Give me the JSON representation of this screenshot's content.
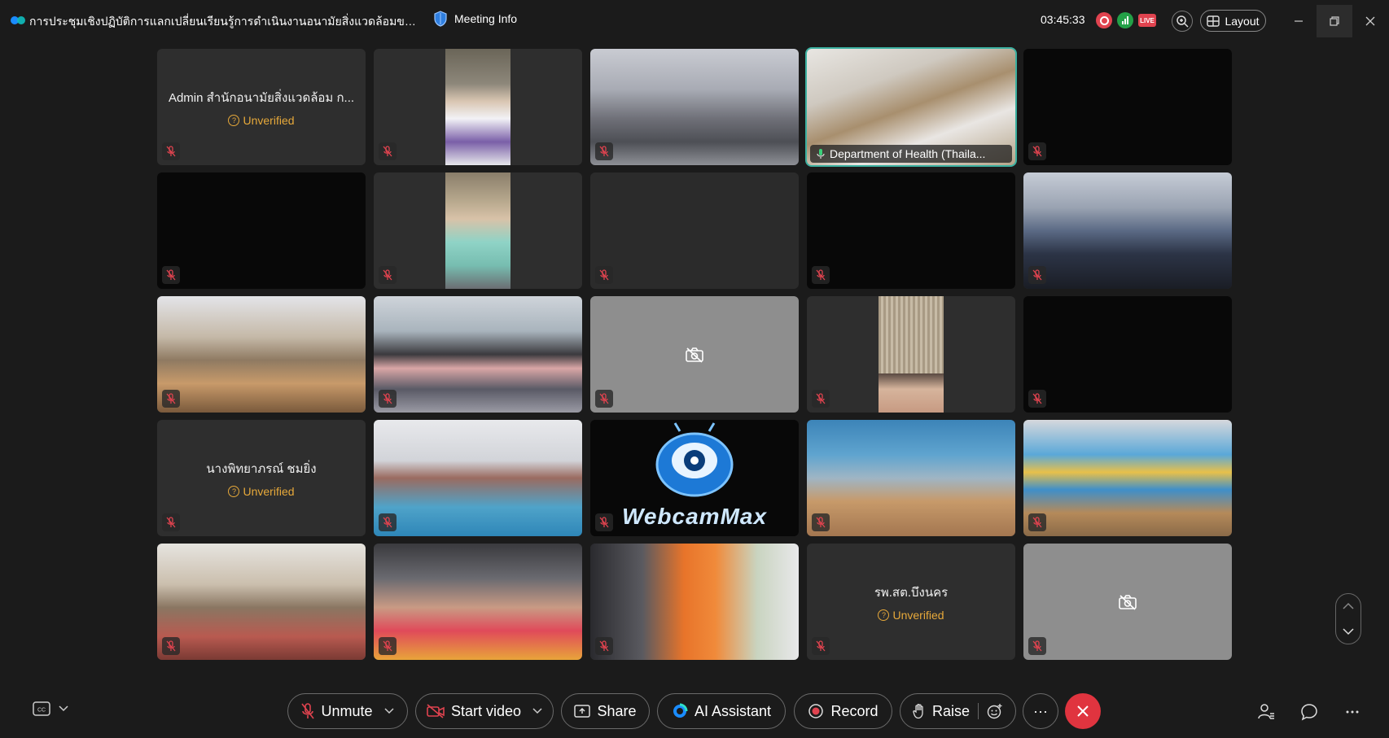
{
  "titlebar": {
    "meeting_title": "การประชุมเชิงปฏิบัติการแลกเปลี่ยนเรียนรู้การดำเนินงานอนามัยสิ่งแวดล้อมของอาสา...",
    "meeting_info_label": "Meeting Info",
    "elapsed_time": "03:45:33",
    "live_badge": "LIVE",
    "layout_label": "Layout"
  },
  "tiles": [
    {
      "name": "Admin สำนักอนามัยสิ่งแวดล้อม ก...",
      "status": "Unverified"
    },
    {
      "name": "Department of Health (Thaila..."
    },
    {
      "name": "นางพิทยาภรณ์ ชมยิ่ง",
      "status": "Unverified"
    },
    {
      "name": "รพ.สต.บึงนคร",
      "status": "Unverified"
    },
    {
      "overlay_text": "WebcamMax"
    }
  ],
  "toolbar": {
    "unmute_label": "Unmute",
    "start_video_label": "Start video",
    "share_label": "Share",
    "ai_assistant_label": "AI Assistant",
    "record_label": "Record",
    "raise_label": "Raise",
    "more_label": "···"
  },
  "colors": {
    "background": "#1b1b1b",
    "end_call": "#e0343f",
    "active_speaker": "#3bb0a0",
    "unverified": "#e7a93a"
  }
}
